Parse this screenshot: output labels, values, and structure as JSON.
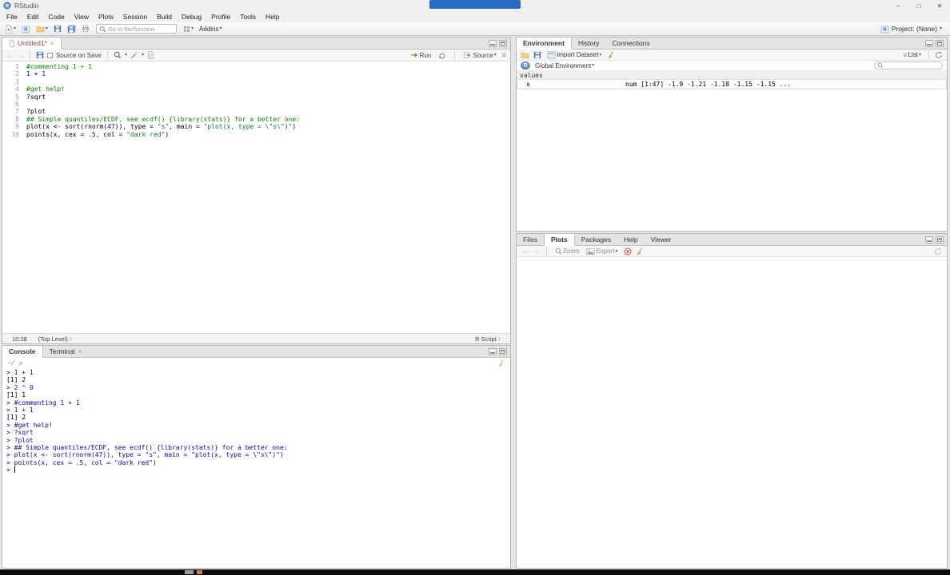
{
  "window": {
    "title": "RStudio",
    "project_label": "Project: (None)"
  },
  "menu": {
    "items": [
      "File",
      "Edit",
      "Code",
      "View",
      "Plots",
      "Session",
      "Build",
      "Debug",
      "Profile",
      "Tools",
      "Help"
    ]
  },
  "toolbar": {
    "goto_placeholder": "Go to file/function",
    "addins_label": "Addins"
  },
  "source_pane": {
    "tab_label": "Untitled1*",
    "toolbar": {
      "source_on_save": "Source on Save",
      "run_label": "Run",
      "source_label": "Source"
    },
    "status": {
      "cursor_position": "10:38",
      "scope": "(Top Level)",
      "file_type": "R Script"
    },
    "code_lines": [
      {
        "num": 1,
        "tokens": [
          {
            "t": "#commenting 1 + 1",
            "c": "comment"
          }
        ]
      },
      {
        "num": 2,
        "tokens": [
          {
            "t": "1",
            "c": "number"
          },
          {
            "t": " + ",
            "c": "plain"
          },
          {
            "t": "1",
            "c": "number"
          }
        ]
      },
      {
        "num": 3,
        "tokens": []
      },
      {
        "num": 4,
        "tokens": [
          {
            "t": "#get help!",
            "c": "comment"
          }
        ]
      },
      {
        "num": 5,
        "tokens": [
          {
            "t": "?sqrt",
            "c": "plain"
          }
        ]
      },
      {
        "num": 6,
        "tokens": []
      },
      {
        "num": 7,
        "tokens": [
          {
            "t": "?plot",
            "c": "plain"
          }
        ]
      },
      {
        "num": 8,
        "tokens": [
          {
            "t": "## Simple quantiles/ECDF, see ecdf() {library(stats)} for a better one:",
            "c": "comment"
          }
        ]
      },
      {
        "num": 9,
        "tokens": [
          {
            "t": "plot(x <- sort(rnorm(",
            "c": "plain"
          },
          {
            "t": "47",
            "c": "number"
          },
          {
            "t": ")), type = ",
            "c": "plain"
          },
          {
            "t": "\"s\"",
            "c": "string"
          },
          {
            "t": ", main = ",
            "c": "plain"
          },
          {
            "t": "\"plot(x, type = \\\"s\\\")\"",
            "c": "string"
          },
          {
            "t": ")",
            "c": "plain"
          }
        ]
      },
      {
        "num": 10,
        "tokens": [
          {
            "t": "points(x, cex = ",
            "c": "plain"
          },
          {
            "t": ".5",
            "c": "number"
          },
          {
            "t": ", col = ",
            "c": "plain"
          },
          {
            "t": "\"dark red\"",
            "c": "string"
          },
          {
            "t": ")",
            "c": "plain"
          }
        ]
      }
    ]
  },
  "console_pane": {
    "tabs": [
      "Console",
      "Terminal"
    ],
    "working_dir": "~/",
    "lines": [
      {
        "t": "> 1 + 1",
        "c": "input"
      },
      {
        "t": "[1] 2",
        "c": "output"
      },
      {
        "t": "> 2 ^ 0",
        "c": "input"
      },
      {
        "t": "[1] 1",
        "c": "output"
      },
      {
        "t": "> #commenting 1 + 1",
        "c": "input"
      },
      {
        "t": "> 1 + 1",
        "c": "input"
      },
      {
        "t": "[1] 2",
        "c": "output"
      },
      {
        "t": "> #get help!",
        "c": "input"
      },
      {
        "t": "> ?sqrt",
        "c": "input"
      },
      {
        "t": "> ?plot",
        "c": "input"
      },
      {
        "t": "> ## Simple quantiles/ECDF, see ecdf() {library(stats)} for a better one:",
        "c": "input"
      },
      {
        "t": "> plot(x <- sort(rnorm(47)), type = \"s\", main = \"plot(x, type = \\\"s\\\")\")",
        "c": "input"
      },
      {
        "t": "> points(x, cex = .5, col = \"dark red\")",
        "c": "input"
      },
      {
        "t": "> ",
        "c": "input",
        "cursor": true
      }
    ]
  },
  "environment_pane": {
    "tabs": [
      "Environment",
      "History",
      "Connections"
    ],
    "toolbar": {
      "import_label": "Import Dataset",
      "list_label": "List"
    },
    "scope_label": "Global Environment",
    "section_header": "values",
    "entries": [
      {
        "name": "x",
        "value": "num [1:47] -1.9 -1.21 -1.18 -1.15 -1.15 ..."
      }
    ]
  },
  "files_pane": {
    "tabs": [
      "Files",
      "Plots",
      "Packages",
      "Help",
      "Viewer"
    ],
    "toolbar": {
      "zoom_label": "Zoom",
      "export_label": "Export"
    }
  }
}
